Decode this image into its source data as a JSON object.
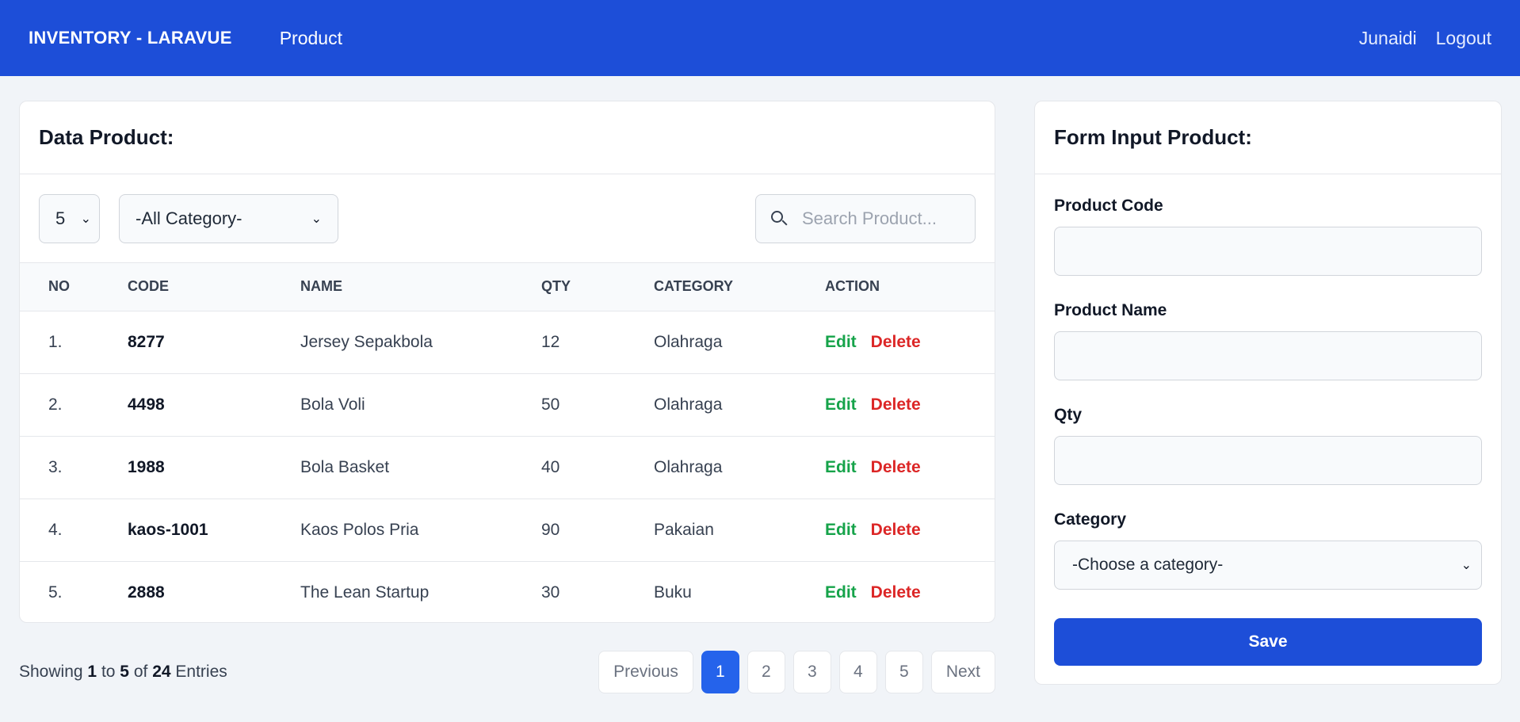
{
  "navbar": {
    "brand": "INVENTORY - LARAVUE",
    "product_link": "Product",
    "user": "Junaidi",
    "logout": "Logout"
  },
  "table_card": {
    "title": "Data Product:",
    "per_page": "5",
    "category_filter": "-All Category-",
    "search_placeholder": "Search Product...",
    "columns": {
      "no": "NO",
      "code": "CODE",
      "name": "NAME",
      "qty": "QTY",
      "category": "CATEGORY",
      "action": "ACTION"
    },
    "rows": [
      {
        "no": "1.",
        "code": "8277",
        "name": "Jersey Sepakbola",
        "qty": "12",
        "category": "Olahraga",
        "edit": "Edit",
        "delete": "Delete"
      },
      {
        "no": "2.",
        "code": "4498",
        "name": "Bola Voli",
        "qty": "50",
        "category": "Olahraga",
        "edit": "Edit",
        "delete": "Delete"
      },
      {
        "no": "3.",
        "code": "1988",
        "name": "Bola Basket",
        "qty": "40",
        "category": "Olahraga",
        "edit": "Edit",
        "delete": "Delete"
      },
      {
        "no": "4.",
        "code": "kaos-1001",
        "name": "Kaos Polos Pria",
        "qty": "90",
        "category": "Pakaian",
        "edit": "Edit",
        "delete": "Delete"
      },
      {
        "no": "5.",
        "code": "2888",
        "name": "The Lean Startup",
        "qty": "30",
        "category": "Buku",
        "edit": "Edit",
        "delete": "Delete"
      }
    ]
  },
  "footer": {
    "showing_prefix": "Showing",
    "from": "1",
    "to_word": "to",
    "to": "5",
    "of_word": "of",
    "total": "24",
    "entries_word": "Entries",
    "previous": "Previous",
    "pages": [
      "1",
      "2",
      "3",
      "4",
      "5"
    ],
    "active_page": "1",
    "next": "Next"
  },
  "form_card": {
    "title": "Form Input Product:",
    "code_label": "Product Code",
    "name_label": "Product Name",
    "qty_label": "Qty",
    "category_label": "Category",
    "category_placeholder": "-Choose a category-",
    "save": "Save"
  },
  "colors": {
    "primary": "#1d4ed8",
    "edit": "#16a34a",
    "delete": "#dc2626",
    "background": "#f1f4f8"
  },
  "icons": {
    "search": "search-icon",
    "dropdown": "chevron-down-icon"
  }
}
